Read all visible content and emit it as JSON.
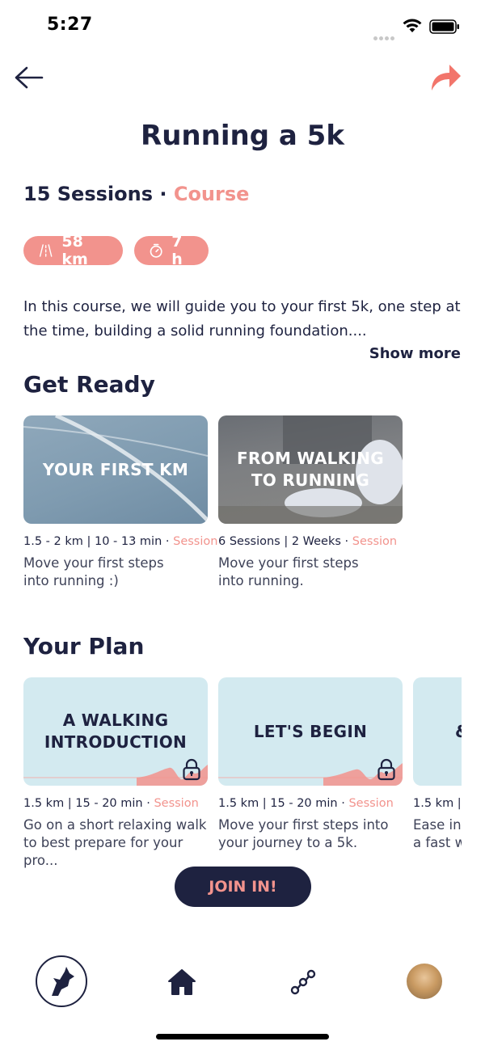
{
  "status_bar": {
    "time": "5:27"
  },
  "header": {
    "title": "Running a 5k"
  },
  "course": {
    "sessions": "15 Sessions",
    "separator": "·",
    "type": "Course",
    "distance": "58 km",
    "duration": "7 h",
    "description": "In this course, we will guide you to your first 5k, one step at the time, building a solid running foundation....",
    "show_more": "Show more"
  },
  "get_ready": {
    "title": "Get Ready",
    "cards": [
      {
        "image_label": "YOUR FIRST KM",
        "meta": "1.5 - 2 km | 10 - 13 min · ",
        "kind": "Session",
        "desc_line1": "Move your first steps",
        "desc_line2": "into running :)"
      },
      {
        "image_label": "FROM WALKING TO RUNNING",
        "meta": "6 Sessions | 2 Weeks · ",
        "kind": "Session",
        "desc_line1": "Move your first steps",
        "desc_line2": "into running."
      }
    ]
  },
  "your_plan": {
    "title": "Your Plan",
    "cards": [
      {
        "image_label": "A WALKING INTRODUCTION",
        "meta": "1.5 km | 15 - 20 min · ",
        "kind": "Session",
        "desc_line1": "Go on a short relaxing walk",
        "desc_line2": "to best prepare for your pro..."
      },
      {
        "image_label": "LET'S BEGIN",
        "meta": "1.5 km | 15 - 20 min · ",
        "kind": "Session",
        "desc_line1": "Move your first steps into",
        "desc_line2": "your journey to a 5k."
      },
      {
        "image_label": "&",
        "meta": "1.5 km |",
        "kind": "",
        "desc_line1": "Ease int",
        "desc_line2": "a fast w"
      }
    ]
  },
  "join_button": "JOIN IN!",
  "icons": {
    "back": "arrow-left-icon",
    "share": "share-arrow-icon",
    "distance": "road-icon",
    "duration": "stopwatch-icon",
    "lock": "lock-icon",
    "tab_logo": "wolf-logo-icon",
    "tab_home": "home-icon",
    "tab_path": "route-icon",
    "tab_profile": "avatar"
  },
  "colors": {
    "navy": "#1e2240",
    "accent": "#f2938d",
    "plan_card_bg": "#d3eaf0"
  }
}
